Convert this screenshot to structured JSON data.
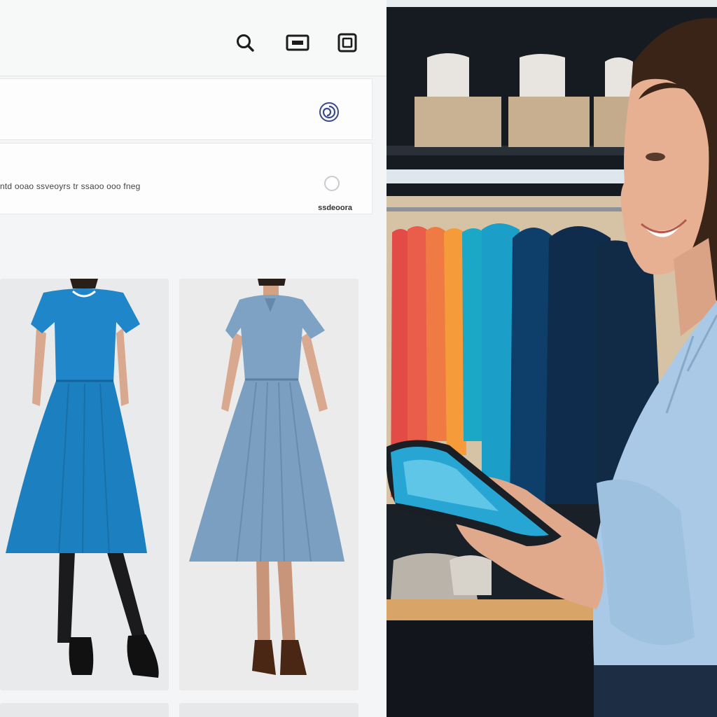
{
  "toolbar": {
    "icons": [
      "search-icon",
      "window-icon",
      "box-icon"
    ]
  },
  "filter_row": {
    "icon": "swirl-icon"
  },
  "info_row": {
    "text": "ntd ooao ssveoyrs tr ssaoo ooo fneg",
    "badge": "ssdeoora"
  },
  "products": [
    {
      "name": "dress-card-royal-blue",
      "color": "#1d8ad0"
    },
    {
      "name": "dress-card-dusty-blue",
      "color": "#7fa3c4"
    }
  ],
  "colors": {
    "panel_bg": "#f4f5f6",
    "accent_blue": "#1d8ad0",
    "store_dark": "#151a21"
  }
}
